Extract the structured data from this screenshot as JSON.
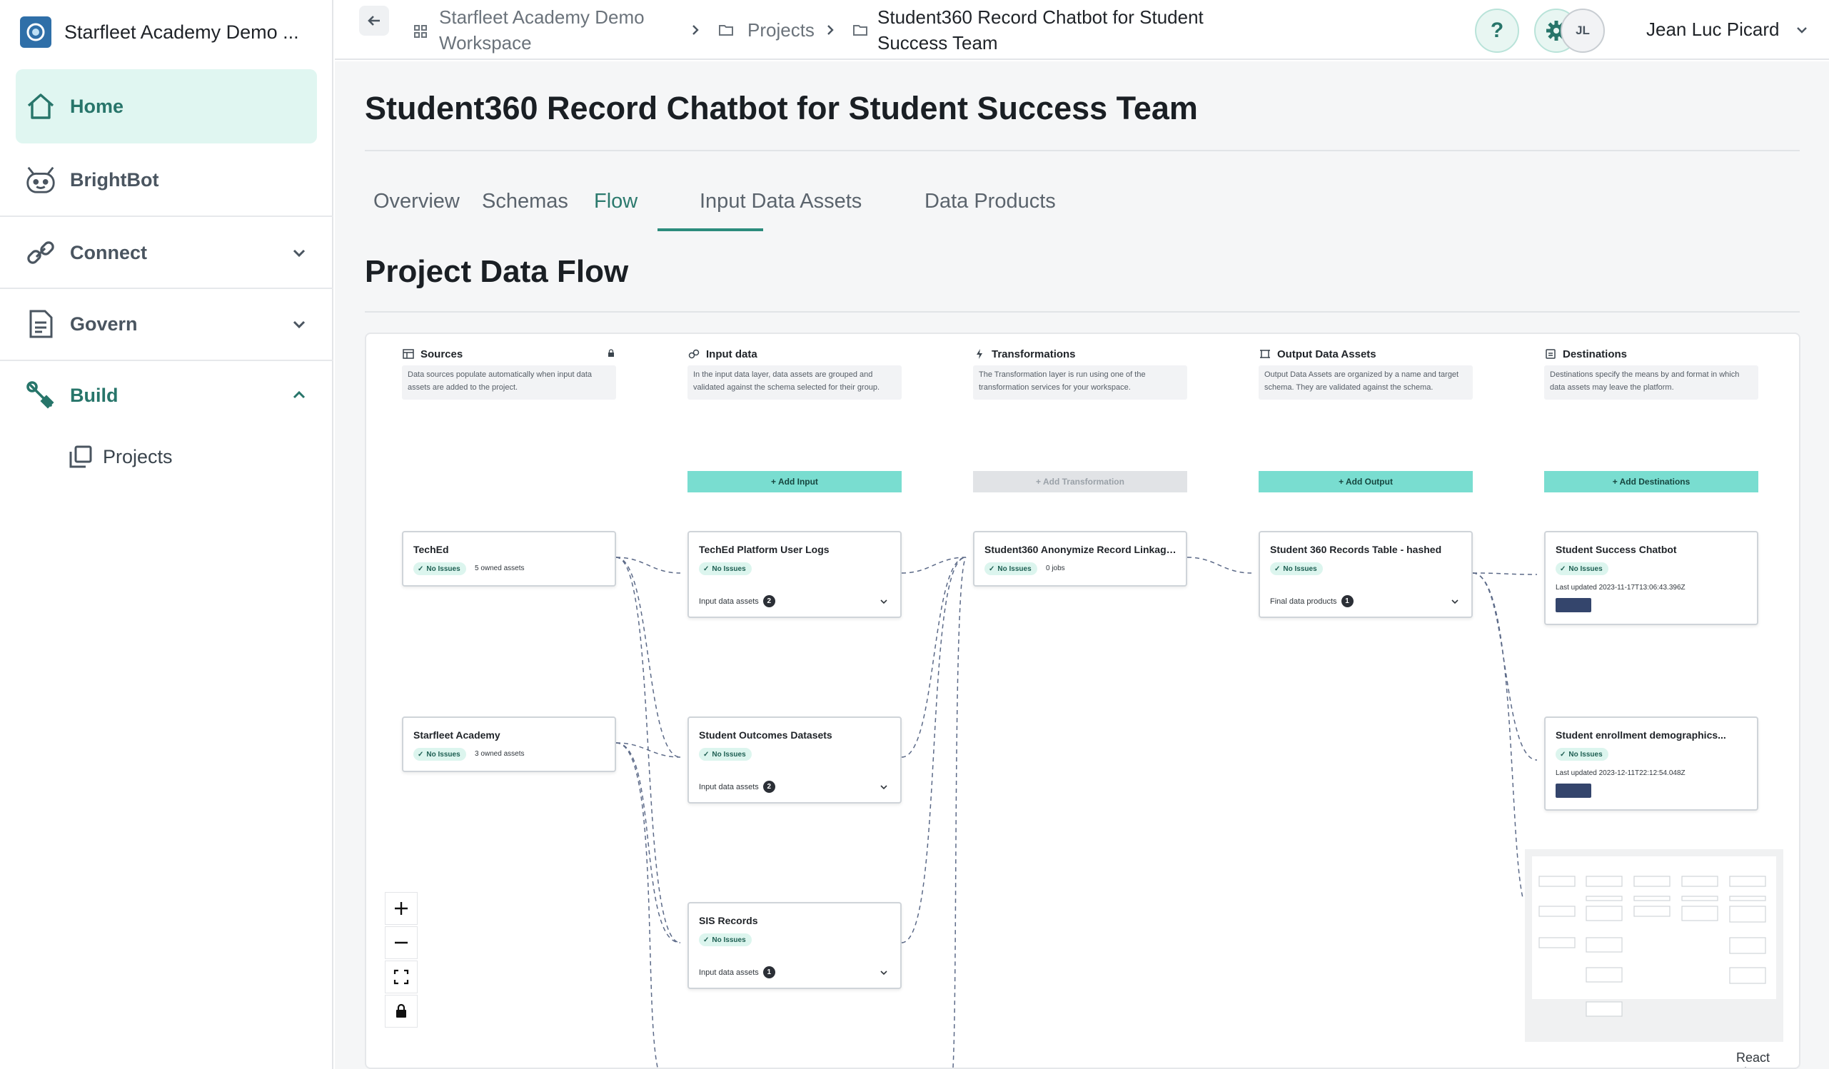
{
  "sidebar": {
    "workspace_name": "Starfleet Academy Demo ...",
    "items": [
      {
        "label": "Home",
        "icon": "home-icon",
        "active": true
      },
      {
        "label": "BrightBot",
        "icon": "robot-icon"
      },
      {
        "label": "Connect",
        "icon": "link-icon",
        "expanded": false
      },
      {
        "label": "Govern",
        "icon": "document-icon",
        "expanded": false
      },
      {
        "label": "Build",
        "icon": "wrench-icon",
        "expanded": true
      }
    ],
    "subitems": [
      {
        "label": "Projects",
        "icon": "folders-icon"
      }
    ]
  },
  "topbar": {
    "breadcrumbs": [
      {
        "line1": "Starfleet Academy Demo",
        "line2": "Workspace",
        "icon": "grid-icon"
      },
      {
        "line1": "Projects",
        "icon": "folder-icon"
      },
      {
        "line1": "Student360 Record Chatbot for Student",
        "line2": "Success Team",
        "icon": "folder-icon"
      }
    ],
    "help_label": "?",
    "user_initials": "JL",
    "user_name": "Jean Luc Picard"
  },
  "page": {
    "title": "Student360 Record Chatbot for Student Success Team",
    "tabs": [
      "Overview",
      "Schemas",
      "Flow",
      "Input Data Assets",
      "Data Products"
    ],
    "active_tab": "Flow",
    "section_title": "Project Data Flow"
  },
  "flow": {
    "columns": [
      {
        "title": "Sources",
        "icon": "table-icon",
        "desc1": "Data sources populate automatically when input data",
        "desc2": "assets are added to the project."
      },
      {
        "title": "Input data",
        "icon": "link-icon",
        "desc1": "In the input data layer, data assets are grouped and",
        "desc2": "validated against the schema selected for their group."
      },
      {
        "title": "Transformations",
        "icon": "bolt-icon",
        "desc1": "The Transformation layer is run using one of the",
        "desc2": "transformation services for your workspace."
      },
      {
        "title": "Output Data Assets",
        "icon": "frame-icon",
        "desc1": "Output Data Assets are organized by a name and target",
        "desc2": "schema. They are validated against the schema."
      },
      {
        "title": "Destinations",
        "icon": "destination-icon",
        "desc1": "Destinations specify the means by and format in which",
        "desc2": "data assets may leave the platform."
      }
    ],
    "add_buttons": [
      "+ Add Input",
      "+ Add Transformation",
      "+ Add Output",
      "+ Add Destinations"
    ],
    "badge_label": "No Issues",
    "sources": [
      {
        "title": "TechEd",
        "meta": "5 owned assets"
      },
      {
        "title": "Starfleet Academy",
        "meta": "3 owned assets"
      }
    ],
    "inputs": [
      {
        "title": "TechEd Platform User Logs",
        "footer": "Input data assets",
        "count": "2"
      },
      {
        "title": "Student Outcomes Datasets",
        "footer": "Input data assets",
        "count": "2"
      },
      {
        "title": "SIS Records",
        "footer": "Input data assets",
        "count": "1"
      }
    ],
    "transformations": [
      {
        "title": "Student360 Anonymize Record Linkage...",
        "meta": "0 jobs"
      }
    ],
    "outputs": [
      {
        "title": "Student 360 Records Table - hashed",
        "footer": "Final data products",
        "count": "1"
      }
    ],
    "destinations": [
      {
        "title": "Student Success Chatbot",
        "updated": "Last updated 2023-11-17T13:06:43.396Z"
      },
      {
        "title": "Student enrollment demographics...",
        "updated": "Last updated 2023-12-11T22:12:54.048Z"
      }
    ],
    "attribution": "React Flow"
  },
  "colors": {
    "accent": "#2c7a6e",
    "accent_bg": "#e0f6f1",
    "add_button": "#79ddd0",
    "badge_bg": "#dcf5ee",
    "dest_bar": "#34456c"
  }
}
